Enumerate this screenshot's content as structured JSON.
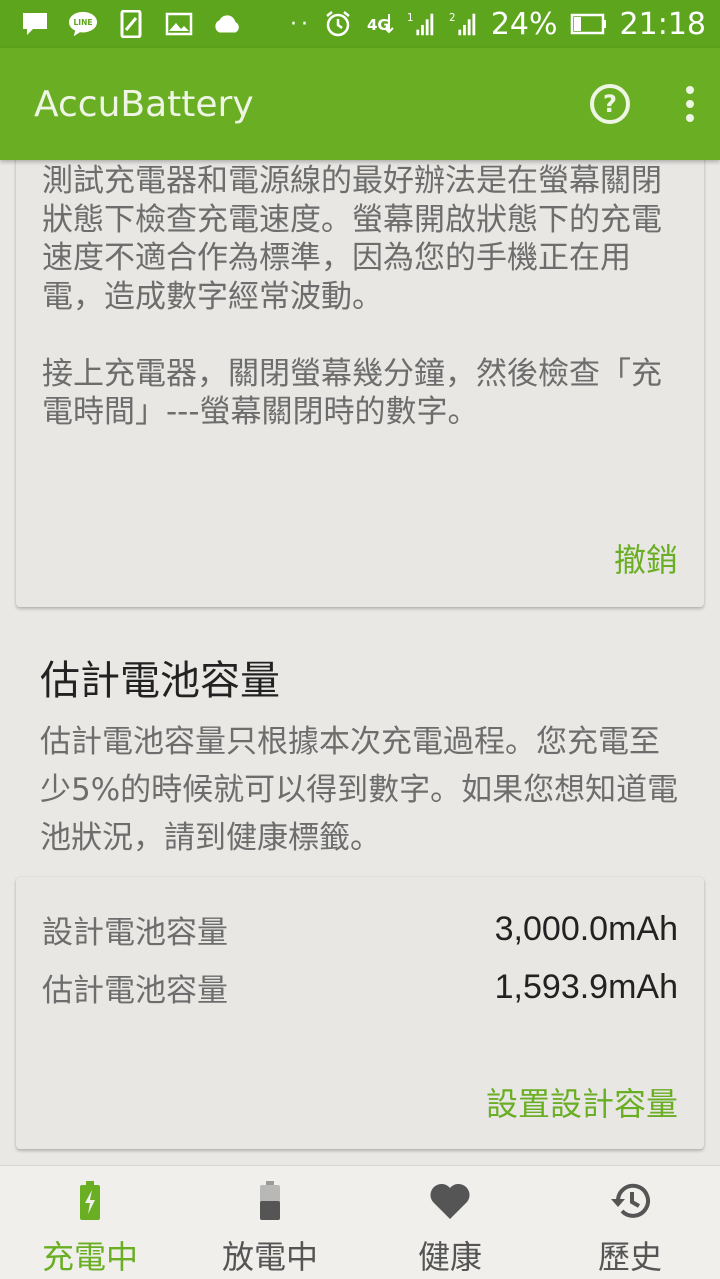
{
  "status_bar": {
    "battery_percent": "24%",
    "time": "21:18",
    "signal1_sim": "1",
    "signal2_sim": "2",
    "network": "4G"
  },
  "app_bar": {
    "title": "AccuBattery",
    "help_symbol": "?"
  },
  "tip_card": {
    "paragraphs": [
      "測試充電器和電源線的最好辦法是在螢幕關閉狀態下檢查充電速度。螢幕開啟狀態下的充電速度不適合作為標準，因為您的手機正在用電，造成數字經常波動。",
      "接上充電器，關閉螢幕幾分鐘，然後檢查「充電時間」---螢幕關閉時的數字。"
    ],
    "dismiss_label": "撤銷"
  },
  "capacity_section": {
    "title": "估計電池容量",
    "description": "估計電池容量只根據本次充電過程。您充電至少5%的時候就可以得到數字。如果您想知道電池狀況，請到健康標籤。",
    "rows": [
      {
        "label": "設計電池容量",
        "value": "3,000.0mAh"
      },
      {
        "label": "估計電池容量",
        "value": "1,593.9mAh"
      }
    ],
    "set_design_label": "設置設計容量"
  },
  "bottom_nav": {
    "items": [
      {
        "label": "充電中",
        "icon": "battery-charging-icon",
        "active": true
      },
      {
        "label": "放電中",
        "icon": "battery-discharging-icon",
        "active": false
      },
      {
        "label": "健康",
        "icon": "heart-icon",
        "active": false
      },
      {
        "label": "歷史",
        "icon": "history-icon",
        "active": false
      }
    ]
  },
  "colors": {
    "accent": "#6aae24",
    "status_bar": "#5da51c",
    "background": "#e9e8e5"
  }
}
